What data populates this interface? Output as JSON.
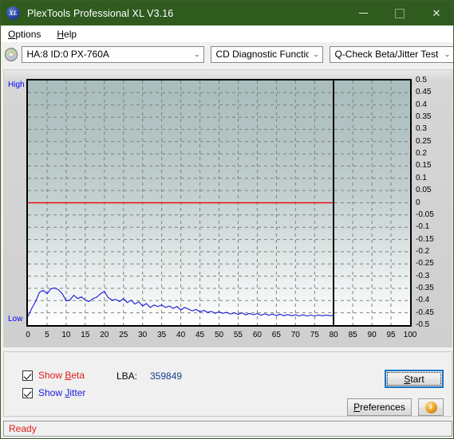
{
  "window": {
    "title": "PlexTools Professional XL V3.16",
    "icon": "xl-disc-icon",
    "icon_text": "XL",
    "titlebar_color": "#2f5b1f",
    "minimize_label": "–",
    "maximize_label": "□",
    "close_label": "✕"
  },
  "menu": {
    "items": [
      {
        "label": "Options",
        "mnemonic": "O"
      },
      {
        "label": "Help",
        "mnemonic": "H"
      }
    ]
  },
  "toolbar": {
    "drive_combo": {
      "value": "HA:8 ID:0  PX-760A",
      "arrow": "⌄"
    },
    "function_combo": {
      "value": "CD Diagnostic Functions",
      "arrow": "⌄"
    },
    "test_combo": {
      "value": "Q-Check Beta/Jitter Test",
      "arrow": "⌄"
    }
  },
  "chart_data": {
    "type": "line",
    "title": "Q-Check Beta/Jitter Test",
    "xlabel": "",
    "ylabel": "",
    "xlim": [
      0,
      100
    ],
    "ylim": [
      -0.5,
      0.5
    ],
    "grid": true,
    "legend_position": "none",
    "y_axis_side": "right",
    "left_axis_labels": {
      "top": "High",
      "bottom": "Low"
    },
    "xticks": [
      0,
      5,
      10,
      15,
      20,
      25,
      30,
      35,
      40,
      45,
      50,
      55,
      60,
      65,
      70,
      75,
      80,
      85,
      90,
      95,
      100
    ],
    "yticks": [
      0.5,
      0.45,
      0.4,
      0.35,
      0.3,
      0.25,
      0.2,
      0.15,
      0.1,
      0.05,
      0,
      -0.05,
      -0.1,
      -0.15,
      -0.2,
      -0.25,
      -0.3,
      -0.35,
      -0.4,
      -0.45,
      -0.5
    ],
    "ytick_labels": [
      "0.5",
      "0.45",
      "0.4",
      "0.35",
      "0.3",
      "0.25",
      "0.2",
      "0.15",
      "0.1",
      "0.05",
      "0",
      "-0.05",
      "-0.1",
      "-0.15",
      "-0.2",
      "-0.25",
      "-0.3",
      "-0.35",
      "-0.4",
      "-0.45",
      "-0.5"
    ],
    "data_end_x": 80,
    "marker_line_x": 80,
    "series": [
      {
        "name": "Beta",
        "color": "#e81212",
        "x": [
          0,
          2,
          4,
          6,
          8,
          10,
          12,
          14,
          16,
          18,
          20,
          22,
          24,
          26,
          28,
          30,
          32,
          34,
          36,
          38,
          40,
          42,
          44,
          46,
          48,
          50,
          52,
          54,
          56,
          58,
          60,
          62,
          64,
          66,
          68,
          70,
          72,
          74,
          76,
          78,
          80
        ],
        "values": [
          0,
          0,
          0,
          0,
          0,
          0,
          0,
          0,
          0,
          0,
          0,
          0,
          0,
          0,
          0,
          0,
          0,
          0,
          0,
          0,
          0,
          0,
          0,
          0,
          0,
          0,
          0,
          0,
          0,
          0,
          0,
          0,
          0,
          0,
          0,
          0,
          0,
          0,
          0,
          0,
          0
        ]
      },
      {
        "name": "Jitter",
        "color": "#1818d8",
        "x": [
          0,
          1,
          2,
          3,
          4,
          5,
          6,
          7,
          8,
          9,
          10,
          11,
          12,
          13,
          14,
          15,
          16,
          17,
          18,
          19,
          20,
          21,
          22,
          23,
          24,
          25,
          26,
          27,
          28,
          29,
          30,
          31,
          32,
          33,
          34,
          35,
          36,
          37,
          38,
          39,
          40,
          41,
          42,
          43,
          44,
          45,
          46,
          47,
          48,
          49,
          50,
          51,
          52,
          53,
          54,
          55,
          56,
          57,
          58,
          59,
          60,
          61,
          62,
          63,
          64,
          65,
          66,
          67,
          68,
          69,
          70,
          71,
          72,
          73,
          74,
          75,
          76,
          77,
          78,
          79,
          80
        ],
        "values": [
          -0.465,
          -0.432,
          -0.404,
          -0.366,
          -0.358,
          -0.372,
          -0.352,
          -0.348,
          -0.356,
          -0.372,
          -0.401,
          -0.398,
          -0.378,
          -0.392,
          -0.385,
          -0.398,
          -0.404,
          -0.392,
          -0.386,
          -0.372,
          -0.362,
          -0.388,
          -0.398,
          -0.395,
          -0.404,
          -0.392,
          -0.408,
          -0.398,
          -0.414,
          -0.405,
          -0.422,
          -0.412,
          -0.428,
          -0.418,
          -0.424,
          -0.418,
          -0.428,
          -0.422,
          -0.432,
          -0.424,
          -0.438,
          -0.428,
          -0.435,
          -0.442,
          -0.436,
          -0.446,
          -0.44,
          -0.448,
          -0.444,
          -0.452,
          -0.446,
          -0.452,
          -0.448,
          -0.455,
          -0.45,
          -0.456,
          -0.45,
          -0.458,
          -0.452,
          -0.458,
          -0.453,
          -0.46,
          -0.454,
          -0.46,
          -0.455,
          -0.461,
          -0.456,
          -0.462,
          -0.457,
          -0.462,
          -0.458,
          -0.463,
          -0.458,
          -0.463,
          -0.459,
          -0.463,
          -0.459,
          -0.462,
          -0.459,
          -0.462,
          -0.46
        ]
      }
    ]
  },
  "controls": {
    "show_beta": {
      "label": "Show Beta",
      "mnemonic": "B",
      "checked": true,
      "color": "#e01b1b"
    },
    "show_jitter": {
      "label": "Show Jitter",
      "mnemonic": "J",
      "checked": true,
      "color": "#1b1be0"
    },
    "lba_label": "LBA:",
    "lba_value": "359849",
    "start_button": "Start",
    "start_mnemonic": "S",
    "preferences_button": "Preferences",
    "preferences_mnemonic": "P",
    "info_button": "i"
  },
  "status": {
    "text": "Ready",
    "color": "#e01b1b"
  }
}
